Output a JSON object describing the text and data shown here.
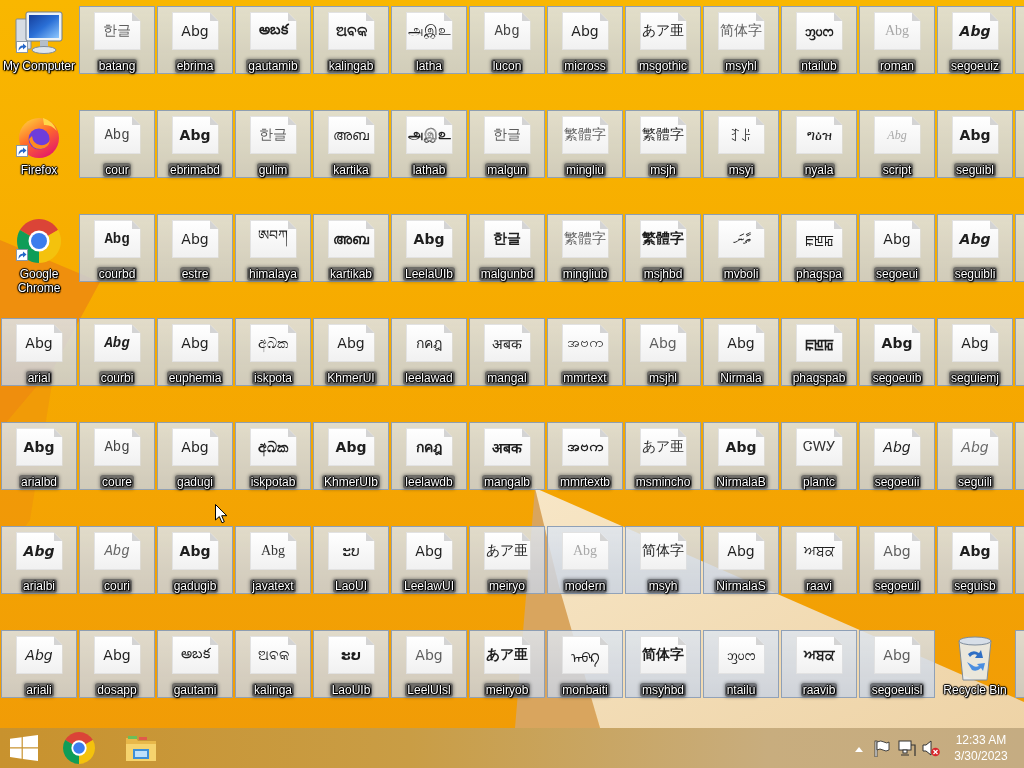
{
  "desktop": {
    "items": [
      {
        "kind": "computer",
        "label": "My Computer",
        "shortcut": true,
        "selected": false
      },
      {
        "kind": "firefox",
        "label": "Firefox",
        "shortcut": true,
        "selected": false
      },
      {
        "kind": "chrome",
        "label": "Google Chrome",
        "shortcut": true,
        "selected": false
      },
      {
        "kind": "font-file",
        "label": "arial",
        "preview": "Abg",
        "shortcut": false,
        "selected": true
      },
      {
        "kind": "font-file",
        "label": "arialbd",
        "preview": "Abg",
        "shortcut": false,
        "selected": true
      },
      {
        "kind": "font-file",
        "label": "arialbi",
        "preview": "Abg",
        "shortcut": false,
        "selected": true
      },
      {
        "kind": "font-file",
        "label": "ariali",
        "preview": "Abg",
        "shortcut": false,
        "selected": true
      },
      {
        "kind": "font-file",
        "label": "batang",
        "preview": "한글",
        "shortcut": false,
        "selected": true
      },
      {
        "kind": "font-file",
        "label": "cour",
        "preview": "Abg",
        "shortcut": false,
        "selected": true
      },
      {
        "kind": "font-file",
        "label": "courbd",
        "preview": "Abg",
        "shortcut": false,
        "selected": true
      },
      {
        "kind": "font-file",
        "label": "courbi",
        "preview": "Abg",
        "shortcut": false,
        "selected": true
      },
      {
        "kind": "font-file",
        "label": "coure",
        "preview": "Abg",
        "shortcut": false,
        "selected": true
      },
      {
        "kind": "font-file",
        "label": "couri",
        "preview": "Abg",
        "shortcut": false,
        "selected": true
      },
      {
        "kind": "font-file",
        "label": "dosapp",
        "preview": "Abg",
        "shortcut": false,
        "selected": true
      },
      {
        "kind": "font-file",
        "label": "ebrima",
        "preview": "Abg",
        "shortcut": false,
        "selected": true
      },
      {
        "kind": "font-file",
        "label": "ebrimabd",
        "preview": "Abg",
        "shortcut": false,
        "selected": true
      },
      {
        "kind": "font-file",
        "label": "estre",
        "preview": "Abg",
        "shortcut": false,
        "selected": true
      },
      {
        "kind": "font-file",
        "label": "euphemia",
        "preview": "Abg",
        "shortcut": false,
        "selected": true
      },
      {
        "kind": "font-file",
        "label": "gadugi",
        "preview": "Abg",
        "shortcut": false,
        "selected": true
      },
      {
        "kind": "font-file",
        "label": "gadugib",
        "preview": "Abg",
        "shortcut": false,
        "selected": true
      },
      {
        "kind": "font-file",
        "label": "gautami",
        "preview": "అబక",
        "shortcut": false,
        "selected": true
      },
      {
        "kind": "font-file",
        "label": "gautamib",
        "preview": "అబక",
        "shortcut": false,
        "selected": true
      },
      {
        "kind": "font-file",
        "label": "gulim",
        "preview": "한글",
        "shortcut": false,
        "selected": true
      },
      {
        "kind": "font-file",
        "label": "himalaya",
        "preview": "ཨབཀ",
        "shortcut": false,
        "selected": true
      },
      {
        "kind": "font-file",
        "label": "iskpota",
        "preview": "අබක",
        "shortcut": false,
        "selected": true
      },
      {
        "kind": "font-file",
        "label": "iskpotab",
        "preview": "අබක",
        "shortcut": false,
        "selected": true
      },
      {
        "kind": "font-file",
        "label": "javatext",
        "preview": "Abg",
        "shortcut": false,
        "selected": true
      },
      {
        "kind": "font-file",
        "label": "kalinga",
        "preview": "ଅବକ",
        "shortcut": false,
        "selected": true
      },
      {
        "kind": "font-file",
        "label": "kalingab",
        "preview": "ଅବକ",
        "shortcut": false,
        "selected": true
      },
      {
        "kind": "font-file",
        "label": "kartika",
        "preview": "അബ",
        "shortcut": false,
        "selected": true
      },
      {
        "kind": "font-file",
        "label": "kartikab",
        "preview": "അബ",
        "shortcut": false,
        "selected": true
      },
      {
        "kind": "font-file",
        "label": "KhmerUI",
        "preview": "Abg",
        "shortcut": false,
        "selected": true
      },
      {
        "kind": "font-file",
        "label": "KhmerUIb",
        "preview": "Abg",
        "shortcut": false,
        "selected": true
      },
      {
        "kind": "font-file",
        "label": "LaoUI",
        "preview": "ະບ",
        "shortcut": false,
        "selected": true
      },
      {
        "kind": "font-file",
        "label": "LaoUIb",
        "preview": "ະບ",
        "shortcut": false,
        "selected": true
      },
      {
        "kind": "font-file",
        "label": "latha",
        "preview": "அஇஉ",
        "shortcut": false,
        "selected": true
      },
      {
        "kind": "font-file",
        "label": "lathab",
        "preview": "அஇஉ",
        "shortcut": false,
        "selected": true
      },
      {
        "kind": "font-file",
        "label": "LeelaUIb",
        "preview": "Abg",
        "shortcut": false,
        "selected": true
      },
      {
        "kind": "font-file",
        "label": "leelawad",
        "preview": "กคฎ",
        "shortcut": false,
        "selected": true
      },
      {
        "kind": "font-file",
        "label": "leelawdb",
        "preview": "กคฎ",
        "shortcut": false,
        "selected": true
      },
      {
        "kind": "font-file",
        "label": "LeelawUI",
        "preview": "Abg",
        "shortcut": false,
        "selected": true
      },
      {
        "kind": "font-file",
        "label": "LeelUIsl",
        "preview": "Abg",
        "shortcut": false,
        "selected": true
      },
      {
        "kind": "font-file",
        "label": "lucon",
        "preview": "Abg",
        "shortcut": false,
        "selected": true
      },
      {
        "kind": "font-file",
        "label": "malgun",
        "preview": "한글",
        "shortcut": false,
        "selected": true
      },
      {
        "kind": "font-file",
        "label": "malgunbd",
        "preview": "한글",
        "shortcut": false,
        "selected": true
      },
      {
        "kind": "font-file",
        "label": "mangal",
        "preview": "अबक",
        "shortcut": false,
        "selected": true
      },
      {
        "kind": "font-file",
        "label": "mangalb",
        "preview": "अबक",
        "shortcut": false,
        "selected": true
      },
      {
        "kind": "font-file",
        "label": "meiryo",
        "preview": "あア亜",
        "shortcut": false,
        "selected": true
      },
      {
        "kind": "font-file",
        "label": "meiryob",
        "preview": "あア亜",
        "shortcut": false,
        "selected": true
      },
      {
        "kind": "font-file",
        "label": "micross",
        "preview": "Abg",
        "shortcut": false,
        "selected": true
      },
      {
        "kind": "font-file",
        "label": "mingliu",
        "preview": "繁體字",
        "shortcut": false,
        "selected": true
      },
      {
        "kind": "font-file",
        "label": "mingliub",
        "preview": "繁體字",
        "shortcut": false,
        "selected": true
      },
      {
        "kind": "font-file",
        "label": "mmrtext",
        "preview": "အဗက",
        "shortcut": false,
        "selected": true
      },
      {
        "kind": "font-file",
        "label": "mmrtextb",
        "preview": "အဗက",
        "shortcut": false,
        "selected": true
      },
      {
        "kind": "font-file",
        "label": "modern",
        "preview": "Abg",
        "shortcut": false,
        "selected": true
      },
      {
        "kind": "font-file",
        "label": "monbaiti",
        "preview": "ᠠᠪᠺ",
        "shortcut": false,
        "selected": true
      },
      {
        "kind": "font-file",
        "label": "msgothic",
        "preview": "あア亜",
        "shortcut": false,
        "selected": true
      },
      {
        "kind": "font-file",
        "label": "msjh",
        "preview": "繁體字",
        "shortcut": false,
        "selected": true
      },
      {
        "kind": "font-file",
        "label": "msjhbd",
        "preview": "繁體字",
        "shortcut": false,
        "selected": true
      },
      {
        "kind": "font-file",
        "label": "msjhl",
        "preview": "Abg",
        "shortcut": false,
        "selected": true
      },
      {
        "kind": "font-file",
        "label": "msmincho",
        "preview": "あア亜",
        "shortcut": false,
        "selected": true
      },
      {
        "kind": "font-file",
        "label": "msyh",
        "preview": "简体字",
        "shortcut": false,
        "selected": true
      },
      {
        "kind": "font-file",
        "label": "msyhbd",
        "preview": "简体字",
        "shortcut": false,
        "selected": true
      },
      {
        "kind": "font-file",
        "label": "msyhl",
        "preview": "简体字",
        "shortcut": false,
        "selected": true
      },
      {
        "kind": "font-file",
        "label": "msyi",
        "preview": "ꆈꌠ",
        "shortcut": false,
        "selected": true
      },
      {
        "kind": "font-file",
        "label": "mvboli",
        "preview": "ތާނަ",
        "shortcut": false,
        "selected": true
      },
      {
        "kind": "font-file",
        "label": "Nirmala",
        "preview": "Abg",
        "shortcut": false,
        "selected": true
      },
      {
        "kind": "font-file",
        "label": "NirmalaB",
        "preview": "Abg",
        "shortcut": false,
        "selected": true
      },
      {
        "kind": "font-file",
        "label": "NirmalaS",
        "preview": "Abg",
        "shortcut": false,
        "selected": true
      },
      {
        "kind": "font-file",
        "label": "ntailu",
        "preview": "ᦀᦢᦂ",
        "shortcut": false,
        "selected": true
      },
      {
        "kind": "font-file",
        "label": "ntailub",
        "preview": "ᦀᦢᦂ",
        "shortcut": false,
        "selected": true
      },
      {
        "kind": "font-file",
        "label": "nyala",
        "preview": "ግዕዝ",
        "shortcut": false,
        "selected": true
      },
      {
        "kind": "font-file",
        "label": "phagspa",
        "preview": "ꡀꡁꡂ",
        "shortcut": false,
        "selected": true
      },
      {
        "kind": "font-file",
        "label": "phagspab",
        "preview": "ꡀꡁꡂ",
        "shortcut": false,
        "selected": true
      },
      {
        "kind": "font-file",
        "label": "plantc",
        "preview": "ᏣᎳᎩ",
        "shortcut": false,
        "selected": true
      },
      {
        "kind": "font-file",
        "label": "raavi",
        "preview": "ਅਬਕ",
        "shortcut": false,
        "selected": true
      },
      {
        "kind": "font-file",
        "label": "raavib",
        "preview": "ਅਬਕ",
        "shortcut": false,
        "selected": true
      },
      {
        "kind": "font-file",
        "label": "roman",
        "preview": "Abg",
        "shortcut": false,
        "selected": true
      },
      {
        "kind": "font-file",
        "label": "script",
        "preview": "Abg",
        "shortcut": false,
        "selected": true
      },
      {
        "kind": "font-file",
        "label": "segoeui",
        "preview": "Abg",
        "shortcut": false,
        "selected": true
      },
      {
        "kind": "font-file",
        "label": "segoeuib",
        "preview": "Abg",
        "shortcut": false,
        "selected": true
      },
      {
        "kind": "font-file",
        "label": "segoeuii",
        "preview": "Abg",
        "shortcut": false,
        "selected": true
      },
      {
        "kind": "font-file",
        "label": "segoeuil",
        "preview": "Abg",
        "shortcut": false,
        "selected": true
      },
      {
        "kind": "font-file",
        "label": "segoeuisl",
        "preview": "Abg",
        "shortcut": false,
        "selected": true
      },
      {
        "kind": "font-file",
        "label": "segoeuiz",
        "preview": "Abg",
        "shortcut": false,
        "selected": true
      },
      {
        "kind": "font-file",
        "label": "seguibl",
        "preview": "Abg",
        "shortcut": false,
        "selected": true
      },
      {
        "kind": "font-file",
        "label": "seguibli",
        "preview": "Abg",
        "shortcut": false,
        "selected": true
      },
      {
        "kind": "font-file",
        "label": "seguiemj",
        "preview": "Abg",
        "shortcut": false,
        "selected": true
      },
      {
        "kind": "font-file",
        "label": "seguili",
        "preview": "Abg",
        "shortcut": false,
        "selected": true
      },
      {
        "kind": "font-file",
        "label": "seguisb",
        "preview": "Abg",
        "shortcut": false,
        "selected": true
      },
      {
        "kind": "recycle-bin",
        "label": "Recycle Bin",
        "shortcut": false,
        "selected": false
      },
      {
        "kind": "partial",
        "selected": true
      },
      {
        "kind": "partial",
        "selected": true
      },
      {
        "kind": "partial",
        "selected": true
      },
      {
        "kind": "partial",
        "selected": true
      },
      {
        "kind": "partial",
        "selected": true
      },
      {
        "kind": "partial",
        "selected": true
      },
      {
        "kind": "partial",
        "selected": true
      }
    ]
  },
  "taskbar": {
    "buttons": [
      {
        "kind": "start"
      },
      {
        "kind": "browser"
      },
      {
        "kind": "file-explorer"
      }
    ],
    "tray": {
      "muted": true,
      "time": "12:33 AM",
      "date": "3/30/2023"
    }
  }
}
